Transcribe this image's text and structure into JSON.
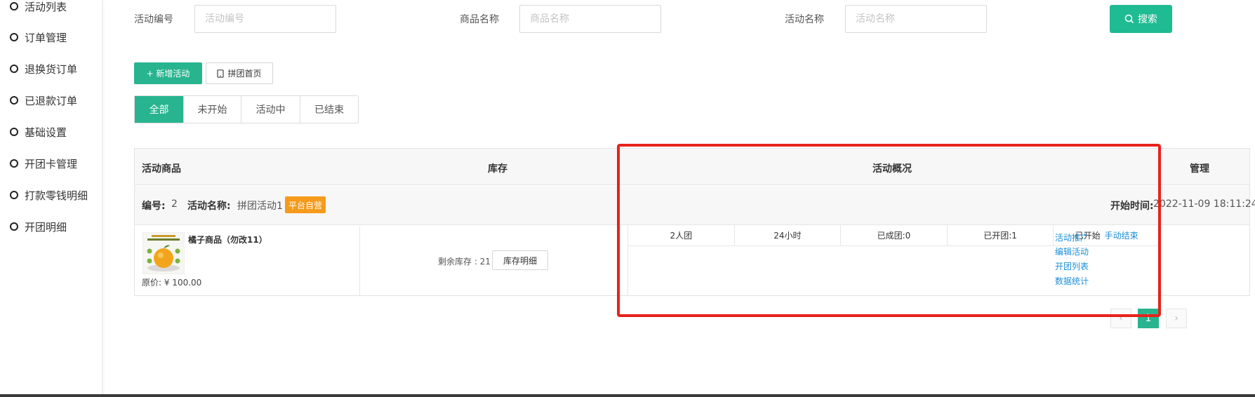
{
  "sidebar": {
    "items": [
      {
        "label": "活动列表"
      },
      {
        "label": "订单管理"
      },
      {
        "label": "退换货订单"
      },
      {
        "label": "已退款订单"
      },
      {
        "label": "基础设置"
      },
      {
        "label": "开团卡管理"
      },
      {
        "label": "打款零钱明细"
      },
      {
        "label": "开团明细"
      }
    ]
  },
  "filters": {
    "activity_no_label": "活动编号",
    "activity_no_placeholder": "活动编号",
    "product_name_label": "商品名称",
    "product_name_placeholder": "商品名称",
    "activity_name_label": "活动名称",
    "activity_name_placeholder": "活动名称",
    "search_label": "搜索"
  },
  "toolbar": {
    "add_label": "+ 新增活动",
    "home_label": "拼团首页"
  },
  "tabs": [
    {
      "label": "全部",
      "active": true
    },
    {
      "label": "未开始"
    },
    {
      "label": "活动中"
    },
    {
      "label": "已结束"
    }
  ],
  "table": {
    "headers": {
      "product": "活动商品",
      "stock": "库存",
      "overview": "活动概况",
      "manage": "管理"
    },
    "row": {
      "id_label": "编号:",
      "id_value": "2",
      "name_label": "活动名称:",
      "name_value": "拼团活动1",
      "badge": "平台自营",
      "start_label": "开始时间:",
      "start_value": "2022-11-09 18:11:24",
      "product_name": "橘子商品（勿改11）",
      "price": "原价: ¥ 100.00",
      "stock_text": "剩余库存 : 21",
      "stock_button": "库存明细",
      "overview": [
        "2人团",
        "24小时",
        "已成团:0",
        "已开团:1"
      ],
      "status": "已开始",
      "end_action": "手动结束",
      "manage_links": [
        "活动推广",
        "编辑活动",
        "开团列表",
        "数据统计"
      ]
    }
  },
  "pagination": {
    "current": "1",
    "prev": "‹",
    "next": "›"
  },
  "colors": {
    "accent": "#27b48f",
    "highlight": "#e8221c",
    "badge": "#f59a1b",
    "link": "#1c8fd6"
  }
}
